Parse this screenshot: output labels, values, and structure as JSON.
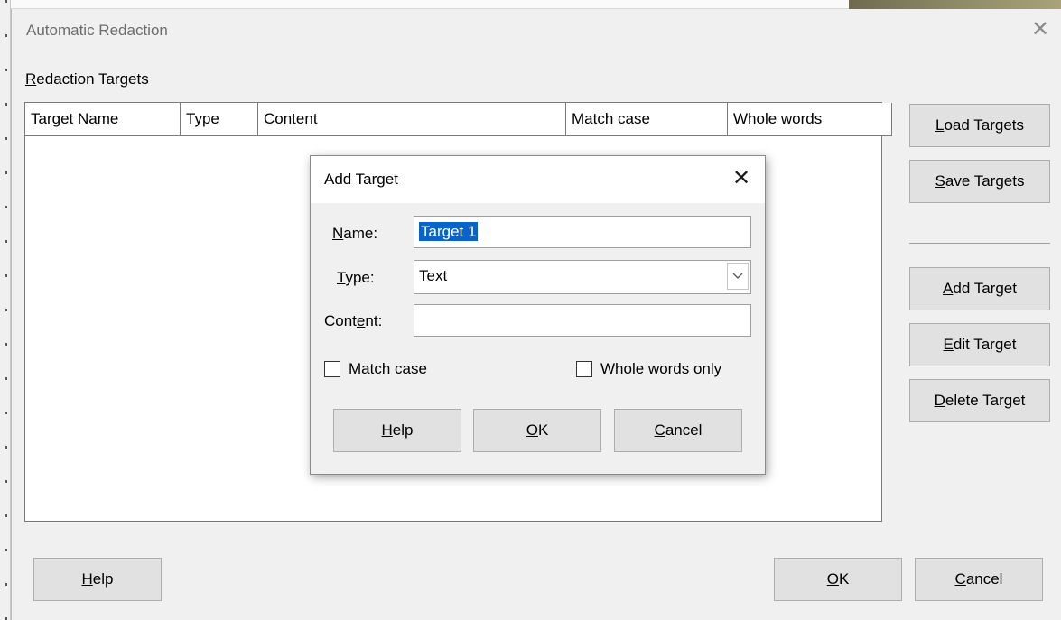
{
  "main_dialog": {
    "title": "Automatic Redaction",
    "targets_label": {
      "pre": "",
      "mn": "R",
      "post": "edaction Targets"
    },
    "table": {
      "columns": [
        "Target Name",
        "Type",
        "Content",
        "Match case",
        "Whole words"
      ],
      "rows": []
    },
    "side_buttons": {
      "load": {
        "pre": "",
        "mn": "L",
        "post": "oad Targets"
      },
      "save": {
        "pre": "",
        "mn": "S",
        "post": "ave Targets"
      },
      "add": {
        "pre": "",
        "mn": "A",
        "post": "dd Target"
      },
      "edit": {
        "pre": "",
        "mn": "E",
        "post": "dit Target"
      },
      "delete": {
        "pre": "",
        "mn": "D",
        "post": "elete Target"
      }
    },
    "bottom_buttons": {
      "help": {
        "pre": "",
        "mn": "H",
        "post": "elp"
      },
      "ok": {
        "pre": "",
        "mn": "O",
        "post": "K"
      },
      "cancel": {
        "pre": "",
        "mn": "C",
        "post": "ancel"
      }
    }
  },
  "add_target_dialog": {
    "title": "Add Target",
    "name_label": {
      "pre": "",
      "mn": "N",
      "post": "ame:"
    },
    "name_value": "Target 1",
    "type_label": {
      "pre": "",
      "mn": "T",
      "post": "ype:"
    },
    "type_value": "Text",
    "content_label": {
      "pre": "Cont",
      "mn": "e",
      "post": "nt:"
    },
    "content_value": "",
    "match_case": {
      "label": {
        "pre": "",
        "mn": "M",
        "post": "atch case"
      },
      "checked": false
    },
    "whole_words": {
      "label": {
        "pre": "",
        "mn": "W",
        "post": "hole words only"
      },
      "checked": false
    },
    "buttons": {
      "help": {
        "pre": "",
        "mn": "H",
        "post": "elp"
      },
      "ok": {
        "pre": "",
        "mn": "O",
        "post": "K"
      },
      "cancel": {
        "pre": "",
        "mn": "C",
        "post": "ancel"
      }
    }
  },
  "icons": {
    "close": "close-icon",
    "dropdown": "chevron-down-icon"
  },
  "colors": {
    "selection": "#0a63c9",
    "button_face": "#e1e1e1",
    "title_text": "#6d6d6d"
  }
}
